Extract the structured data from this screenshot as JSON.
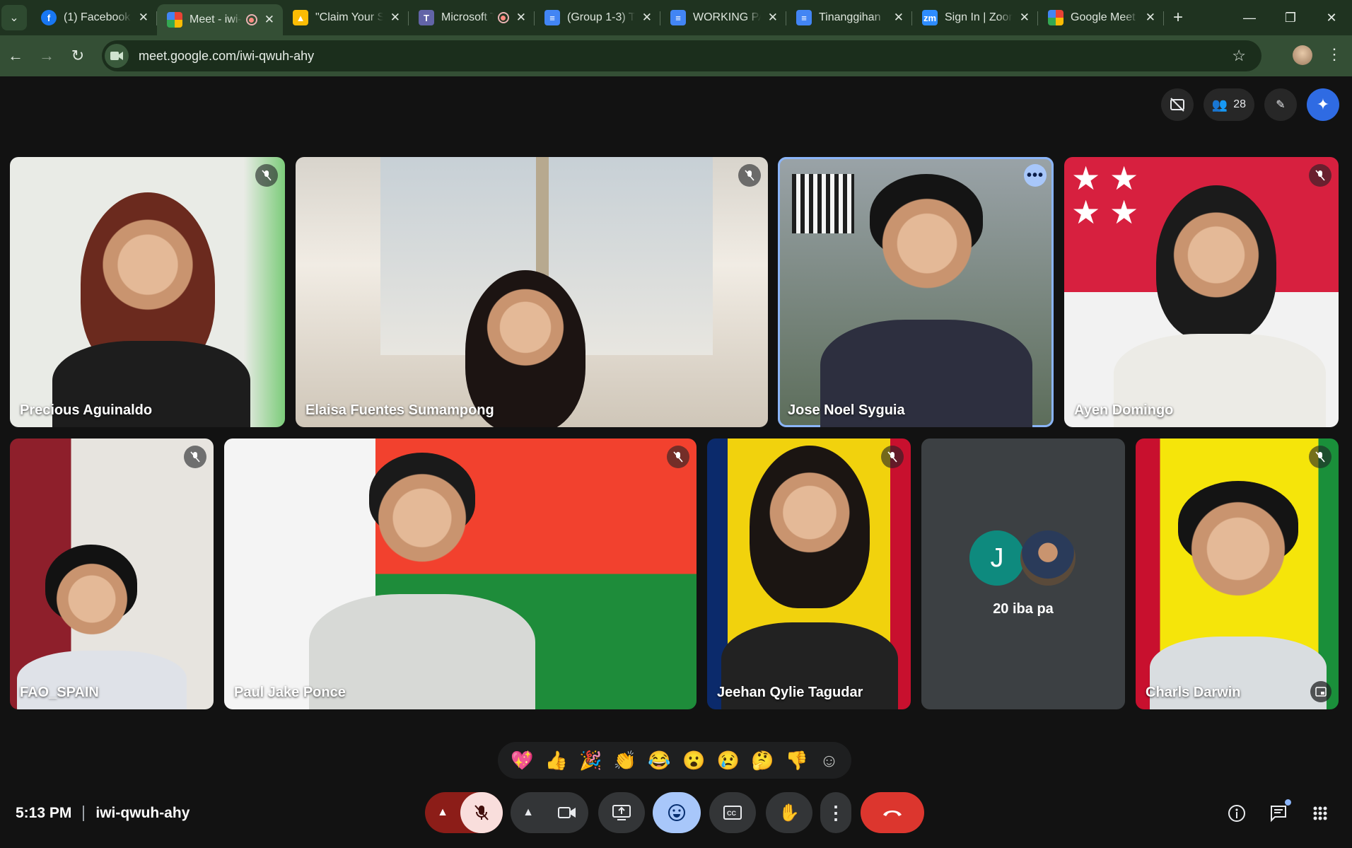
{
  "browser": {
    "tabs": [
      {
        "title": "(1) Facebook",
        "favicon": "facebook-icon",
        "color": "#1877f2",
        "glyph": "f"
      },
      {
        "title": "Meet - iwi-qwuh-ahy",
        "favicon": "google-meet-icon",
        "color": "#34a853",
        "glyph": "",
        "active": true,
        "recording": true
      },
      {
        "title": "\"Claim Your Spot",
        "favicon": "google-drive-icon",
        "color": "#fbbc04",
        "glyph": "▲"
      },
      {
        "title": "Microsoft Teams",
        "favicon": "teams-icon",
        "color": "#6264a7",
        "glyph": "T",
        "recording": true
      },
      {
        "title": "(Group 1-3) T",
        "favicon": "google-docs-icon",
        "color": "#4285f4",
        "glyph": "≡"
      },
      {
        "title": "WORKING PAPER",
        "favicon": "google-docs-icon",
        "color": "#4285f4",
        "glyph": "≡"
      },
      {
        "title": "Tinanggihan",
        "favicon": "google-docs-icon",
        "color": "#4285f4",
        "glyph": "≡"
      },
      {
        "title": "Sign In | Zoom",
        "favicon": "zoom-icon",
        "color": "#2d8cff",
        "glyph": "zm"
      },
      {
        "title": "Google Meet",
        "favicon": "google-meet-icon",
        "color": "#34a853",
        "glyph": ""
      }
    ],
    "url": "meet.google.com/iwi-qwuh-ahy"
  },
  "meet": {
    "participant_count": "28",
    "participants_row1": [
      {
        "name": "Precious Aguinaldo"
      },
      {
        "name": "Elaisa Fuentes Sumampong"
      },
      {
        "name": "Jose Noel Syguia"
      },
      {
        "name": "Ayen Domingo"
      }
    ],
    "participants_row2": [
      {
        "name": "FAO_SPAIN"
      },
      {
        "name": "Paul Jake Ponce"
      },
      {
        "name": "Jeehan Qylie Tagudar"
      },
      {
        "name": "Charls Darwin"
      }
    ],
    "others": {
      "avatar_letter": "J",
      "label": "20 iba pa"
    },
    "reactions": [
      "💖",
      "👍",
      "🎉",
      "👏",
      "😂",
      "😮",
      "😢",
      "🤔",
      "👎"
    ],
    "time": "5:13 PM",
    "meeting_code": "iwi-qwuh-ahy"
  }
}
